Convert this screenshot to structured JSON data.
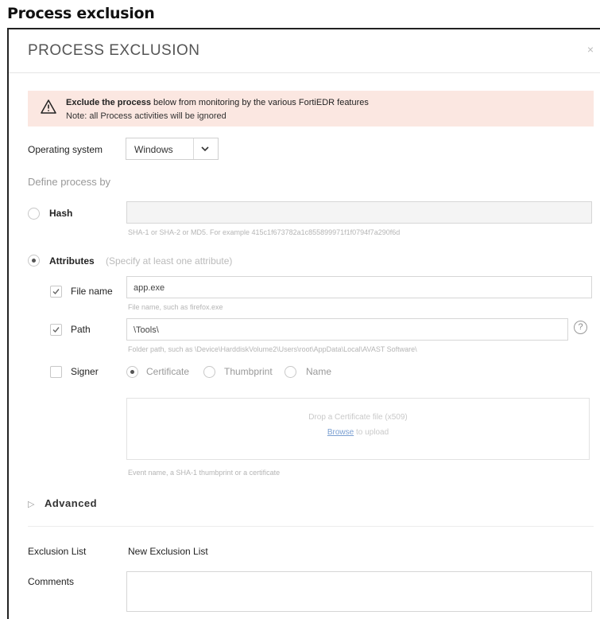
{
  "page_heading": "Process exclusion",
  "dialog": {
    "title": "PROCESS EXCLUSION",
    "close_label": "×"
  },
  "warning": {
    "bold": "Exclude the process",
    "rest": " below from monitoring by the various FortiEDR features",
    "note": "Note: all Process activities will be ignored"
  },
  "os": {
    "label": "Operating system",
    "value": "Windows"
  },
  "define_label": "Define process by",
  "hash": {
    "label": "Hash",
    "selected": false,
    "value": "",
    "hint": "SHA-1 or SHA-2 or MD5. For example 415c1f673782a1c855899971f1f0794f7a290f6d"
  },
  "attributes": {
    "label": "Attributes",
    "sublabel": "(Specify at least one attribute)",
    "selected": true,
    "file_name": {
      "label": "File name",
      "checked": true,
      "value": "app.exe",
      "hint": "File name, such as firefox.exe"
    },
    "path": {
      "label": "Path",
      "checked": true,
      "value": "\\Tools\\",
      "hint": "Folder path, such as \\Device\\HarddiskVolume2\\Users\\root\\AppData\\Local\\AVAST Software\\",
      "help": "?"
    },
    "signer": {
      "label": "Signer",
      "checked": false,
      "options": [
        "Certificate",
        "Thumbprint",
        "Name"
      ],
      "selected_option": "Certificate",
      "drop_text": "Drop a Certificate file (x509)",
      "browse_link": "Browse",
      "browse_rest": " to upload",
      "hint": "Event name, a SHA-1 thumbprint or a certificate"
    }
  },
  "advanced": {
    "arrow": "▷",
    "label": "Advanced"
  },
  "exclusion_list": {
    "label": "Exclusion List",
    "value": "New Exclusion List"
  },
  "comments": {
    "label": "Comments",
    "value": ""
  }
}
